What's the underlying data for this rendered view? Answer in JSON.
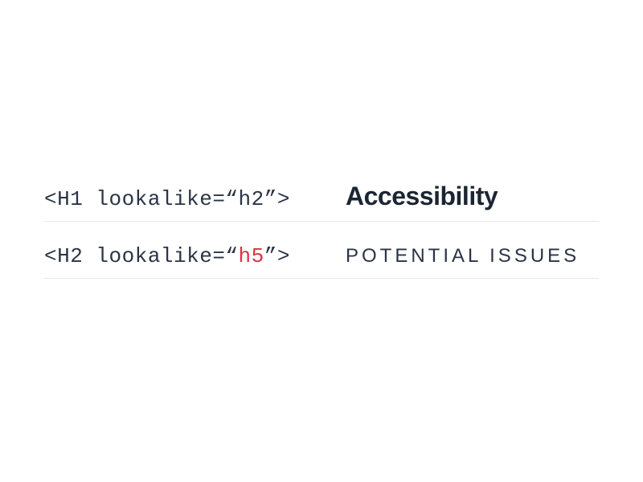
{
  "rows": [
    {
      "code_prefix": "<H1 lookalike=“",
      "code_attr": "h2",
      "code_suffix": "”>",
      "attr_highlighted": false,
      "rendered_text": "Accessibility",
      "rendered_style": "h2"
    },
    {
      "code_prefix": "<H2 lookalike=“",
      "code_attr": "h5",
      "code_suffix": "”>",
      "attr_highlighted": true,
      "rendered_text": "POTENTIAL ISSUES",
      "rendered_style": "h5"
    }
  ]
}
